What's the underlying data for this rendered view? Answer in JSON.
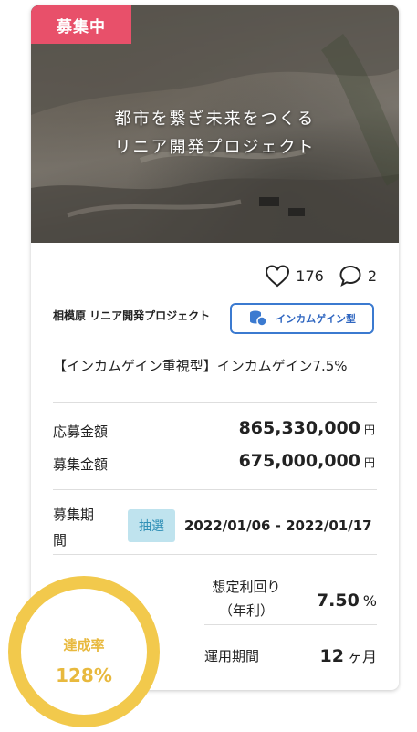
{
  "status_badge": "募集中",
  "hero": {
    "line1": "都市を繋ぎ未来をつくる",
    "line2": "リニア開発プロジェクト"
  },
  "reactions": {
    "likes": "176",
    "comments": "2"
  },
  "project_name": "相模原 リニア開発プロジェクト",
  "type_button": "インカムゲイン型",
  "offering_title": "【インカムゲイン重視型】インカムゲイン7.5%",
  "application": {
    "label": "応募金額",
    "value": "865,330,000",
    "unit": "円"
  },
  "target": {
    "label": "募集金額",
    "value": "675,000,000",
    "unit": "円"
  },
  "period": {
    "label": "募集期間",
    "method": "抽選",
    "value": "2022/01/06 - 2022/01/17"
  },
  "yield": {
    "label_line1": "想定利回り",
    "label_line2": "（年利）",
    "value": "7.50",
    "unit": "%"
  },
  "term": {
    "label": "運用期間",
    "value": "12",
    "unit": "ヶ月"
  },
  "achievement": {
    "label": "達成率",
    "value": "128%",
    "percent": 128
  },
  "colors": {
    "badge": "#e8506a",
    "accent_blue": "#3b7ad0",
    "ring": "#f2c94c",
    "lottery_bg": "#bfe3ee"
  }
}
